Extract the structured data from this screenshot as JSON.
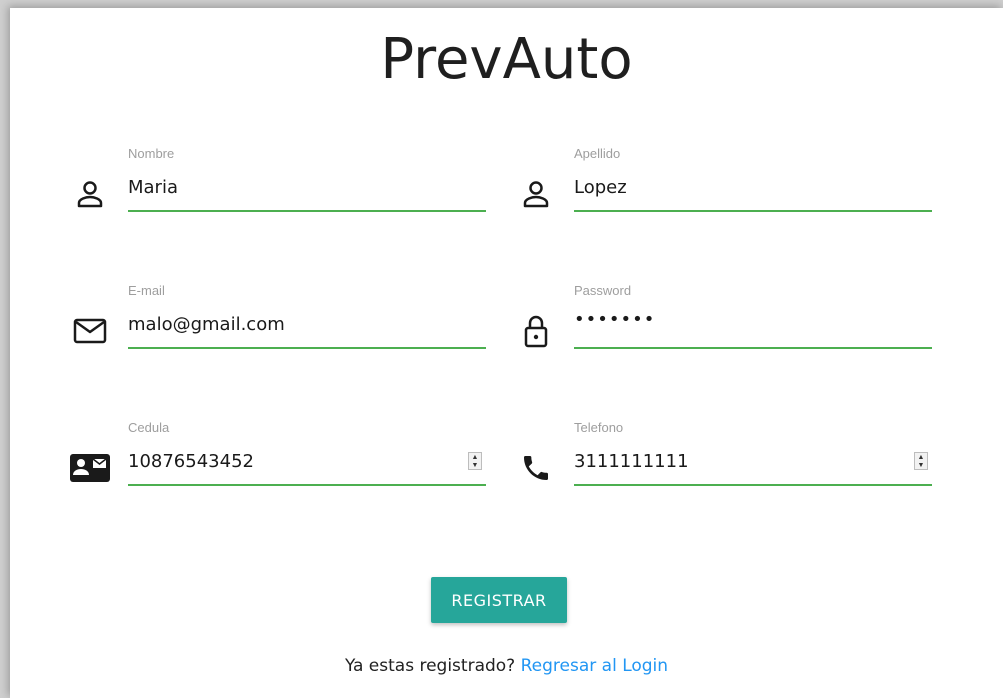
{
  "app": {
    "title": "PrevAuto"
  },
  "form": {
    "nombre": {
      "label": "Nombre",
      "value": "Maria",
      "icon": "person-icon"
    },
    "apellido": {
      "label": "Apellido",
      "value": "Lopez",
      "icon": "person-icon"
    },
    "email": {
      "label": "E-mail",
      "value": "malo@gmail.com",
      "icon": "mail-icon"
    },
    "password": {
      "label": "Password",
      "value": "•••••••",
      "icon": "lock-icon"
    },
    "cedula": {
      "label": "Cedula",
      "value": "10876543452",
      "icon": "contact-card-icon"
    },
    "telefono": {
      "label": "Telefono",
      "value": "3111111111",
      "icon": "phone-icon"
    }
  },
  "actions": {
    "register_label": "REGISTRAR"
  },
  "footer": {
    "prompt": "Ya estas registrado? ",
    "link_label": "Regresar al Login"
  },
  "colors": {
    "accent_underline": "#4caf50",
    "button": "#26a69a",
    "link": "#2196f3"
  }
}
